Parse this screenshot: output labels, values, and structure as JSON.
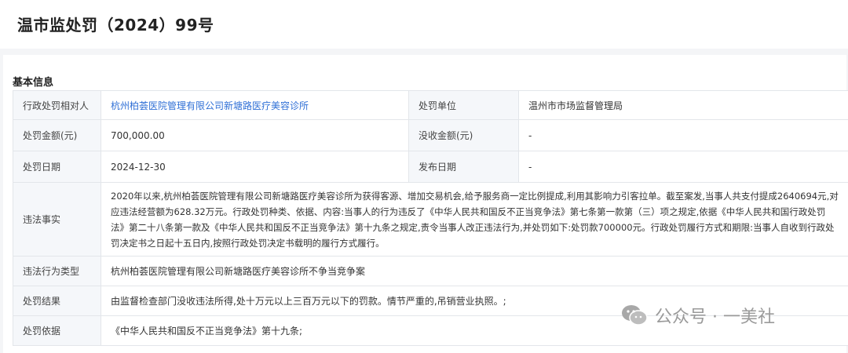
{
  "header": {
    "title": "温市监处罚（2024）99号"
  },
  "section": {
    "title": "基本信息"
  },
  "rows": {
    "party_label": "行政处罚相对人",
    "party_value": "杭州柏荟医院管理有限公司新塘路医疗美容诊所",
    "authority_label": "处罚单位",
    "authority_value": "温州市市场监督管理局",
    "amount_label": "处罚金额(元)",
    "amount_value": "700,000.00",
    "confiscation_label": "没收金额(元)",
    "confiscation_value": "-",
    "date_label": "处罚日期",
    "date_value": "2024-12-30",
    "publish_label": "发布日期",
    "publish_value": "-",
    "facts_label": "违法事实",
    "facts_value": "2020年以来,杭州柏荟医院管理有限公司新塘路医疗美容诊所为获得客源、增加交易机会,给予服务商一定比例提成,利用其影响力引客拉单。截至案发,当事人共支付提成2640694元,对应违法经营额为628.32万元。行政处罚种类、依据、内容:当事人的行为违反了《中华人民共和国反不正当竞争法》第七条第一款第（三）项之规定,依据《中华人民共和国行政处罚法》第二十八条第一款及《中华人民共和国反不正当竞争法》第十九条之规定,责令当事人改正违法行为,并处罚如下:处罚款700000元。行政处罚履行方式和期限:当事人自收到行政处罚决定书之日起十五日内,按照行政处罚决定书载明的履行方式履行。",
    "type_label": "违法行为类型",
    "type_value": "杭州柏荟医院管理有限公司新塘路医疗美容诊所不争当竞争案",
    "result_label": "处罚结果",
    "result_value": "由监督检查部门没收违法所得,处十万元以上三百万元以下的罚款。情节严重的,吊销营业执照。;",
    "basis_label": "处罚依据",
    "basis_value": "《中华人民共和国反不正当竞争法》第十九条;"
  },
  "watermark": {
    "text": "公众号 · 一美社",
    "icon": "wechat-icon"
  }
}
